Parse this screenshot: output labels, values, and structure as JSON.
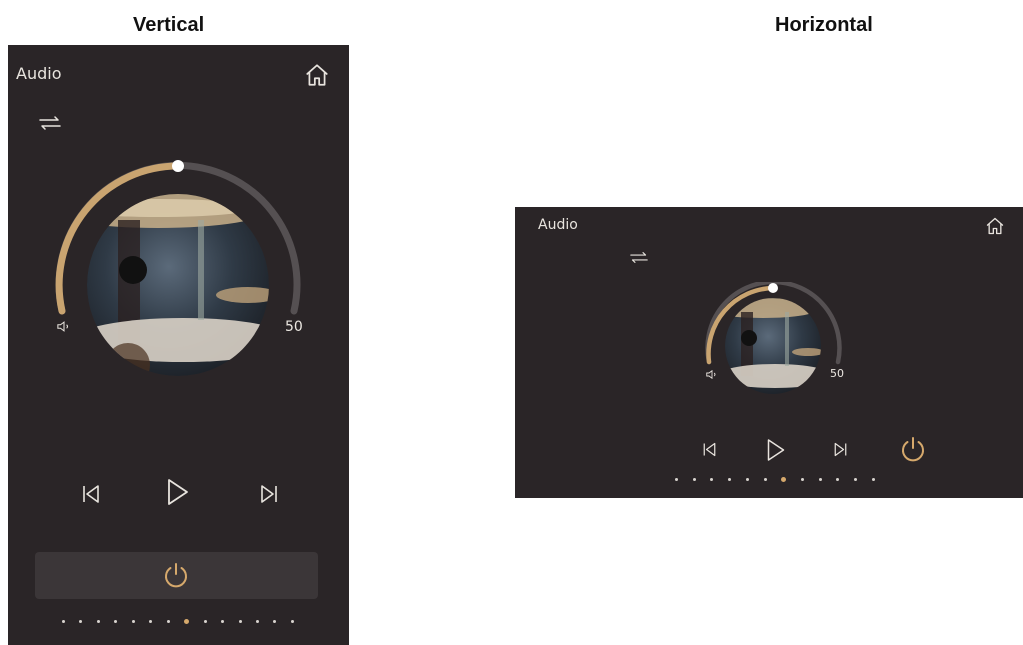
{
  "headings": {
    "vertical": "Vertical",
    "horizontal": "Horizontal"
  },
  "vertical": {
    "app_title": "Audio",
    "volume_value": "50",
    "volume_level": 0.5,
    "page_count": 14,
    "active_page": 8
  },
  "horizontal": {
    "app_title": "Audio",
    "volume_value": "50",
    "volume_level": 0.5,
    "page_count": 12,
    "active_page": 7
  },
  "icons": [
    "home-icon",
    "shuffle-icon",
    "speaker-icon",
    "previous-icon",
    "play-icon",
    "next-icon",
    "power-icon"
  ],
  "colors": {
    "panel_bg": "#2a2527",
    "accent": "#d6a96c",
    "text": "#e8e4de",
    "track": "#555052"
  }
}
